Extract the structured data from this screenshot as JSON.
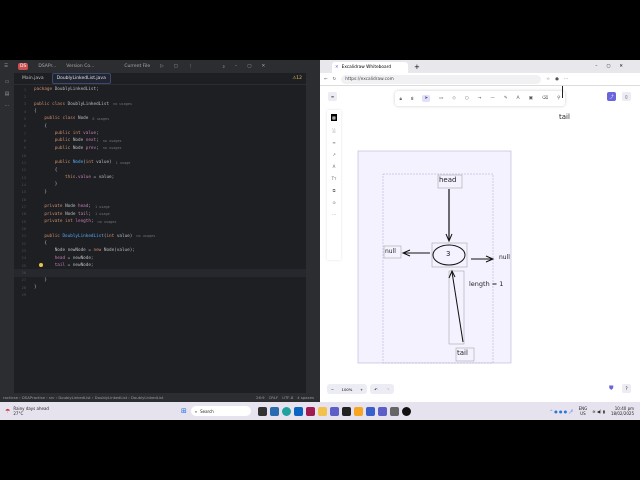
{
  "ide": {
    "title": {
      "project_badge": "DS",
      "project": "DSAPr...",
      "vcs": "Version Co...",
      "run_config": "Current File"
    },
    "tabs": [
      {
        "label": "Main.java",
        "active": false
      },
      {
        "label": "DoublyLinkedList.java",
        "active": true
      }
    ],
    "warnings": "⚠12",
    "code": [
      {
        "n": "1",
        "t": [
          [
            "kw",
            "package "
          ],
          [
            "ty",
            "DoublyLinkedList;"
          ]
        ]
      },
      {
        "n": "2",
        "t": []
      },
      {
        "n": "3",
        "t": [
          [
            "kw",
            "public class "
          ],
          [
            "ty",
            "DoublyLinkedList"
          ],
          [
            "hint",
            "no usages"
          ]
        ]
      },
      {
        "n": "4",
        "t": [
          [
            "ty",
            "{"
          ]
        ]
      },
      {
        "n": "5",
        "t": [
          [
            "ty",
            "    "
          ],
          [
            "kw",
            "public class "
          ],
          [
            "ty",
            "Node"
          ],
          [
            "hint",
            "6 usages"
          ]
        ]
      },
      {
        "n": "6",
        "t": [
          [
            "ty",
            "    {"
          ]
        ]
      },
      {
        "n": "7",
        "t": [
          [
            "ty",
            "        "
          ],
          [
            "kw",
            "public int "
          ],
          [
            "fld",
            "value"
          ],
          [
            "ty",
            ";"
          ]
        ]
      },
      {
        "n": "8",
        "t": [
          [
            "ty",
            "        "
          ],
          [
            "kw",
            "public "
          ],
          [
            "ty",
            "Node "
          ],
          [
            "fld",
            "next"
          ],
          [
            "ty",
            ";"
          ],
          [
            "hint",
            "no usages"
          ]
        ]
      },
      {
        "n": "9",
        "t": [
          [
            "ty",
            "        "
          ],
          [
            "kw",
            "public "
          ],
          [
            "ty",
            "Node "
          ],
          [
            "fld",
            "prev"
          ],
          [
            "ty",
            ";"
          ],
          [
            "hint",
            "no usages"
          ]
        ]
      },
      {
        "n": "10",
        "t": []
      },
      {
        "n": "11",
        "t": [
          [
            "ty",
            "        "
          ],
          [
            "kw",
            "public "
          ],
          [
            "fn",
            "Node"
          ],
          [
            "ty",
            "("
          ],
          [
            "kw",
            "int "
          ],
          [
            "ty",
            "value)"
          ],
          [
            "hint",
            "1 usage"
          ]
        ]
      },
      {
        "n": "12",
        "t": [
          [
            "ty",
            "        {"
          ]
        ]
      },
      {
        "n": "13",
        "t": [
          [
            "ty",
            "            "
          ],
          [
            "kw",
            "this"
          ],
          [
            "ty",
            "."
          ],
          [
            "fld",
            "value"
          ],
          [
            "ty",
            " = value;"
          ]
        ]
      },
      {
        "n": "14",
        "t": [
          [
            "ty",
            "        }"
          ]
        ]
      },
      {
        "n": "15",
        "t": [
          [
            "ty",
            "    }"
          ]
        ]
      },
      {
        "n": "16",
        "t": []
      },
      {
        "n": "17",
        "t": [
          [
            "ty",
            "    "
          ],
          [
            "kw",
            "private "
          ],
          [
            "ty",
            "Node "
          ],
          [
            "fld",
            "head"
          ],
          [
            "ty",
            ";"
          ],
          [
            "hint",
            "1 usage"
          ]
        ]
      },
      {
        "n": "18",
        "t": [
          [
            "ty",
            "    "
          ],
          [
            "kw",
            "private "
          ],
          [
            "ty",
            "Node "
          ],
          [
            "fld",
            "tail"
          ],
          [
            "ty",
            ";"
          ],
          [
            "hint",
            "1 usage"
          ]
        ]
      },
      {
        "n": "19",
        "t": [
          [
            "ty",
            "    "
          ],
          [
            "kw",
            "private int "
          ],
          [
            "fld",
            "length"
          ],
          [
            "ty",
            ";"
          ],
          [
            "hint",
            "no usages"
          ]
        ]
      },
      {
        "n": "20",
        "t": []
      },
      {
        "n": "21",
        "t": [
          [
            "ty",
            "    "
          ],
          [
            "kw",
            "public "
          ],
          [
            "fn",
            "DoublyLinkedList"
          ],
          [
            "ty",
            "("
          ],
          [
            "kw",
            "int "
          ],
          [
            "ty",
            "value)"
          ],
          [
            "hint",
            "no usages"
          ]
        ]
      },
      {
        "n": "22",
        "t": [
          [
            "ty",
            "    {"
          ]
        ]
      },
      {
        "n": "23",
        "t": [
          [
            "ty",
            "        Node newNode = "
          ],
          [
            "kw",
            "new "
          ],
          [
            "ty",
            "Node(value);"
          ]
        ]
      },
      {
        "n": "24",
        "t": [
          [
            "ty",
            "        "
          ],
          [
            "fld",
            "head"
          ],
          [
            "ty",
            " = newNode;"
          ]
        ]
      },
      {
        "n": "25",
        "t": [
          [
            "ty",
            "        "
          ],
          [
            "fld",
            "tail"
          ],
          [
            "ty",
            " = newNode;"
          ]
        ]
      },
      {
        "n": "26",
        "t": []
      },
      {
        "n": "27",
        "t": [
          [
            "ty",
            "    }"
          ]
        ]
      },
      {
        "n": "28",
        "t": [
          [
            "ty",
            "}"
          ]
        ]
      },
      {
        "n": "29",
        "t": []
      }
    ],
    "status": {
      "breadcrumb": [
        "racticse",
        "DSAPractise",
        "src",
        "DoublyLinkedList",
        "DoublyLinkedList",
        "DoublyLinkedList"
      ],
      "position": "26:9",
      "line_sep": "CRLF",
      "encoding": "UTF-8",
      "indent": "4 spaces"
    }
  },
  "browser": {
    "tab_title": "Excalidraw Whiteboard",
    "url": "https://excalidraw.com",
    "zoom": "100%",
    "diagram": {
      "head": "head",
      "node_value": "3",
      "null_left": "null",
      "null_right": "null",
      "length": "length = 1",
      "tail": "tail",
      "tail_top": "tail"
    }
  },
  "taskbar": {
    "weather": "Rainy days ahead",
    "temp": "27°C",
    "search": "Search",
    "lang": "ENG",
    "region": "US",
    "time": "10:40 pm",
    "date": "18/02/2025"
  }
}
